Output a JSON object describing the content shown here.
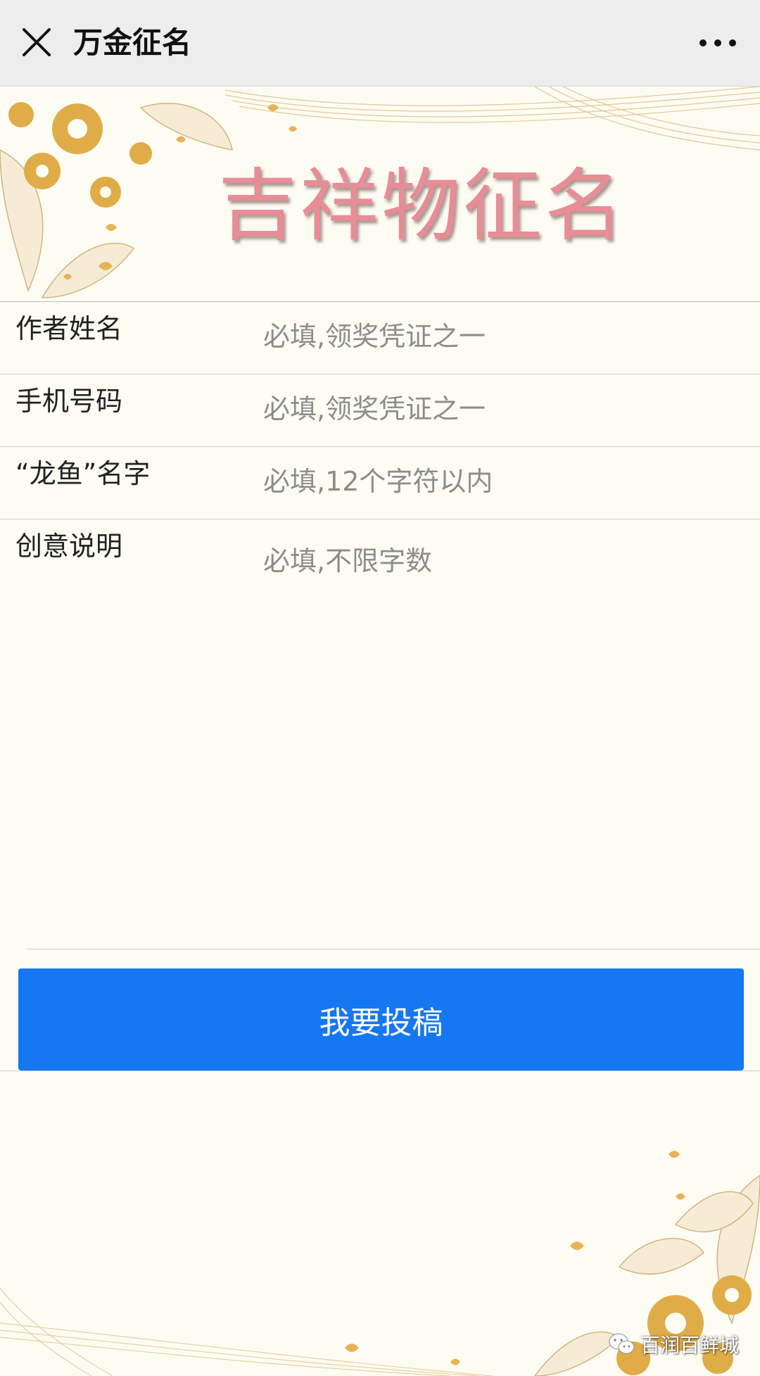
{
  "nav": {
    "title": "万金征名",
    "close_icon": "close-icon",
    "more_icon": "more-dots-icon"
  },
  "banner": {
    "title": "吉祥物征名"
  },
  "form": {
    "rows": [
      {
        "label": "作者姓名",
        "placeholder": "必填,领奖凭证之一"
      },
      {
        "label": "手机号码",
        "placeholder": "必填,领奖凭证之一"
      },
      {
        "label": "“龙鱼”名字",
        "placeholder": "必填,12个字符以内"
      },
      {
        "label": "创意说明",
        "placeholder": "必填,不限字数"
      }
    ],
    "submit_label": "我要投稿"
  },
  "watermark": {
    "text": "百润百鲜城",
    "icon": "wechat-icon"
  },
  "colors": {
    "primary_button": "#1577f2",
    "banner_title": "#e88c96",
    "background": "#fdfcf3",
    "gold_ornament": "#e0ac47"
  }
}
